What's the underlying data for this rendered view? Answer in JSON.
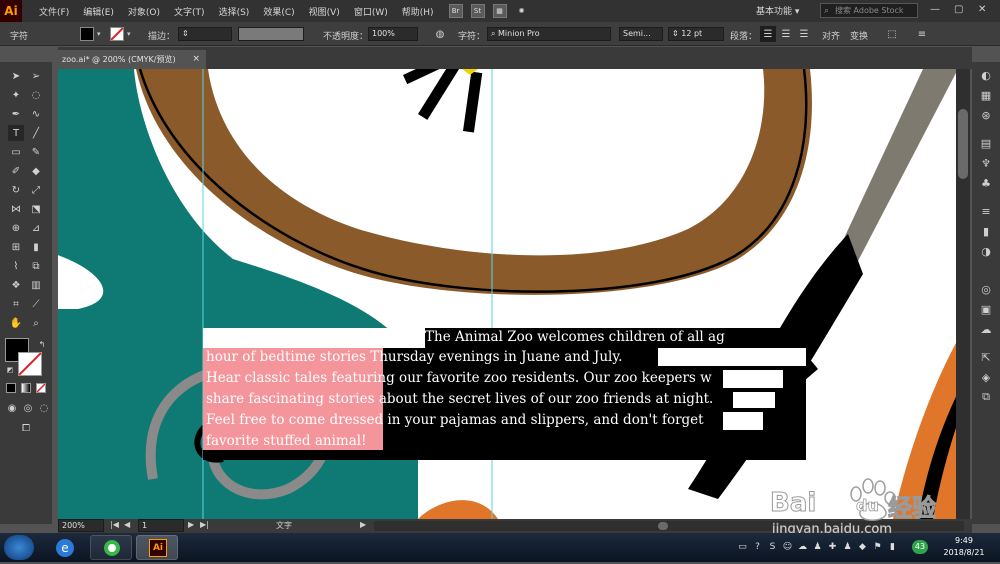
{
  "app": {
    "logo": "Ai"
  },
  "menu": [
    "文件(F)",
    "编辑(E)",
    "对象(O)",
    "文字(T)",
    "选择(S)",
    "效果(C)",
    "视图(V)",
    "窗口(W)",
    "帮助(H)"
  ],
  "menu_buttons": [
    "Br",
    "St"
  ],
  "workspace": "基本功能",
  "stock_search": {
    "placeholder": "搜索 Adobe Stock"
  },
  "control": {
    "panel_label": "字符",
    "stroke_label": "描边：",
    "opacity_label": "不透明度：",
    "opacity_value": "100%",
    "char_label": "字符：",
    "font_name": "Minion Pro",
    "font_style": "Semi...",
    "font_size": "12 pt",
    "paragraph_label": "段落：",
    "align_label": "对齐",
    "transform_label": "变换"
  },
  "document": {
    "tab_title": "zoo.ai* @ 200% (CMYK/预览)",
    "close": "×"
  },
  "status": {
    "zoom": "200%",
    "page": "1",
    "tool": "文字"
  },
  "text_lines": [
    "The Animal Zoo welcomes children of all ag",
    "hour of bedtime stories Thursday evenings in Juane and July.",
    "Hear classic tales featuring our favorite zoo residents.  Our zoo keepers w",
    "share fascinating stories about the secret lives of our zoo friends at night.",
    "Feel free to come dressed in your pajamas and slippers, and don't forget",
    "favorite stuffed animal!"
  ],
  "clock": {
    "time": "9:49",
    "date": "2018/8/21"
  },
  "tray_badge": "43",
  "watermark": {
    "brand": "Bai",
    "brand_end": "du",
    "brand_cn": "经验",
    "url": "jingyan.baidu.com"
  },
  "colors": {
    "teal": "#0e7a73",
    "brown": "#8b5a2b",
    "highlight": "#f4949b",
    "orange": "#e0762a",
    "guide": "#57d6e0"
  }
}
